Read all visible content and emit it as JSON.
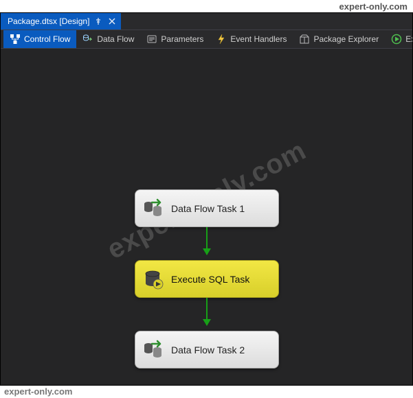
{
  "watermark": {
    "top": "expert-only.com",
    "bottom": "expert-only.com",
    "diagonal": "expert-only.com"
  },
  "document_tab": {
    "label": "Package.dtsx [Design]"
  },
  "toolbar": {
    "items": [
      {
        "label": "Control Flow",
        "icon": "control-flow-icon",
        "active": true
      },
      {
        "label": "Data Flow",
        "icon": "data-flow-icon",
        "active": false
      },
      {
        "label": "Parameters",
        "icon": "parameters-icon",
        "active": false
      },
      {
        "label": "Event Handlers",
        "icon": "event-handlers-icon",
        "active": false
      },
      {
        "label": "Package Explorer",
        "icon": "package-explorer-icon",
        "active": false
      },
      {
        "label": "Execution Resul",
        "icon": "execution-results-icon",
        "active": false
      }
    ]
  },
  "tasks": [
    {
      "id": "task1",
      "label": "Data Flow Task 1",
      "style": "grey",
      "icon": "data-flow-task-icon"
    },
    {
      "id": "task2",
      "label": "Execute SQL Task",
      "style": "yellow",
      "icon": "execute-sql-icon"
    },
    {
      "id": "task3",
      "label": "Data Flow Task 2",
      "style": "grey",
      "icon": "data-flow-task-icon"
    }
  ],
  "colors": {
    "accent": "#0a5bbf",
    "canvas": "#252526",
    "success_arrow": "#17a017"
  }
}
